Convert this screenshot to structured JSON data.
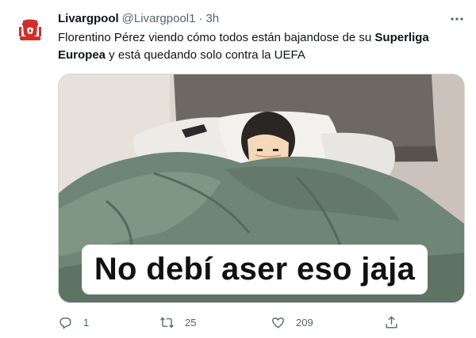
{
  "tweet": {
    "display_name": "Livargpool",
    "handle": "@Livargpool1",
    "separator": "·",
    "time": "3h",
    "text_part1": "Florentino Pérez viendo cómo todos están bajandose de su ",
    "text_bold1": "Superliga",
    "text_part2": " ",
    "text_bold2": "Europea",
    "text_part3": " y está quedando solo contra la UEFA",
    "media": {
      "caption": "No debí aser eso jaja"
    },
    "actions": {
      "reply_count": "1",
      "retweet_count": "25",
      "like_count": "209"
    }
  },
  "colors": {
    "text_primary": "#0f1419",
    "text_secondary": "#536471",
    "avatar_red": "#d42b2b",
    "border": "#cfd9de"
  },
  "icons": {
    "avatar": "liverpool-crest-icon",
    "more": "more-horizontal-icon",
    "reply": "reply-icon",
    "retweet": "retweet-icon",
    "like": "heart-icon",
    "share": "share-icon"
  }
}
